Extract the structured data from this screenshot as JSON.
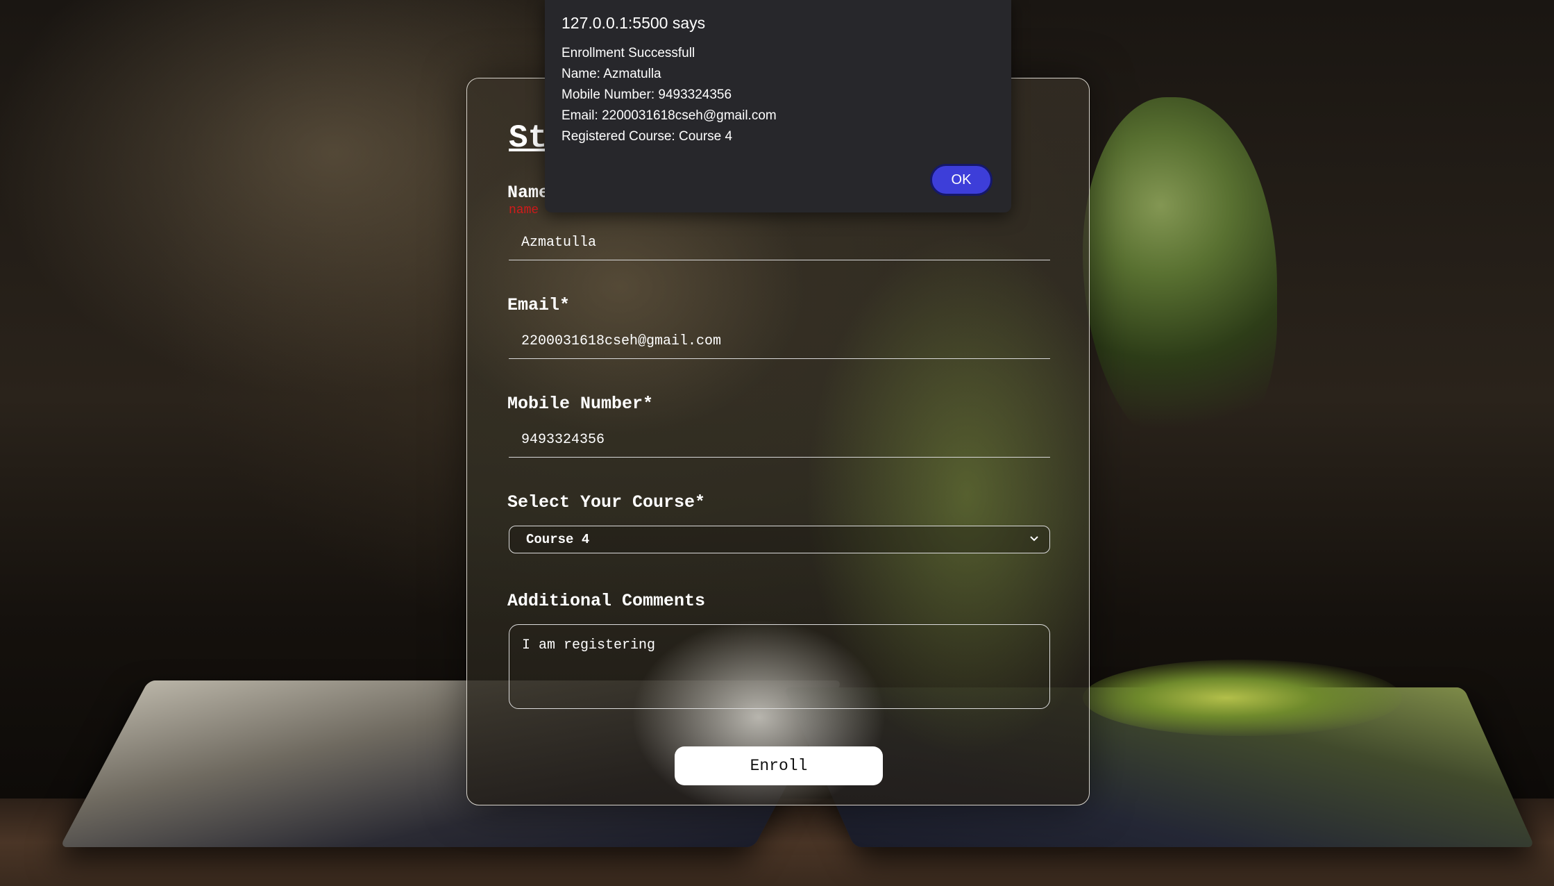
{
  "alert": {
    "title": "127.0.0.1:5500 says",
    "lines": [
      "Enrollment Successfull",
      "Name: Azmatulla",
      "Mobile Number: 9493324356",
      "Email: 2200031618cseh@gmail.com",
      "Registered Course: Course 4"
    ],
    "ok_label": "OK",
    "button_color": "#3d3ed9"
  },
  "form": {
    "title": "St",
    "name_label": "Name",
    "name_error": "name",
    "name_value": "Azmatulla",
    "email_label": "Email*",
    "email_value": "2200031618cseh@gmail.com",
    "mobile_label": "Mobile Number*",
    "mobile_value": "9493324356",
    "course_label": "Select Your Course*",
    "course_value": "Course 4",
    "comments_label": "Additional Comments",
    "comments_value": "I am registering",
    "enroll_label": "Enroll",
    "error_color": "#d21b1b"
  }
}
